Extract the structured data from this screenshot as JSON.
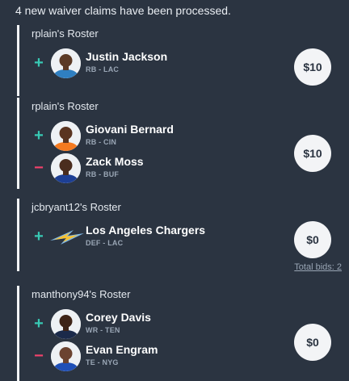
{
  "header": "4 new waiver claims have been processed.",
  "colors": {
    "plus": "#38c9b4",
    "minus": "#f0426b",
    "background": "#2b3441"
  },
  "claims": [
    {
      "roster": "rplain's Roster",
      "players": [
        {
          "action": "+",
          "name": "Justin Jackson",
          "meta": "RB - LAC",
          "icon": "player-avatar"
        }
      ],
      "bid": "$10"
    },
    {
      "roster": "rplain's Roster",
      "players": [
        {
          "action": "+",
          "name": "Giovani Bernard",
          "meta": "RB - CIN",
          "icon": "player-avatar"
        },
        {
          "action": "−",
          "name": "Zack Moss",
          "meta": "RB - BUF",
          "icon": "player-avatar"
        }
      ],
      "bid": "$10"
    },
    {
      "roster": "jcbryant12's Roster",
      "players": [
        {
          "action": "+",
          "name": "Los Angeles Chargers",
          "meta": "DEF - LAC",
          "icon": "chargers-bolt-logo"
        }
      ],
      "bid": "$0",
      "total_bids": "Total bids: 2"
    },
    {
      "roster": "manthony94's Roster",
      "players": [
        {
          "action": "+",
          "name": "Corey Davis",
          "meta": "WR - TEN",
          "icon": "player-avatar"
        },
        {
          "action": "−",
          "name": "Evan Engram",
          "meta": "TE - NYG",
          "icon": "player-avatar"
        }
      ],
      "bid": "$0"
    }
  ]
}
